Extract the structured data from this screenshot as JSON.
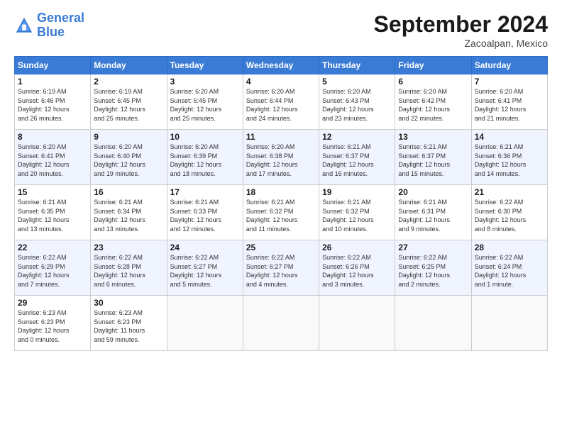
{
  "logo": {
    "line1": "General",
    "line2": "Blue"
  },
  "title": "September 2024",
  "subtitle": "Zacoalpan, Mexico",
  "headers": [
    "Sunday",
    "Monday",
    "Tuesday",
    "Wednesday",
    "Thursday",
    "Friday",
    "Saturday"
  ],
  "weeks": [
    [
      {
        "day": "1",
        "sunrise": "6:19 AM",
        "sunset": "6:46 PM",
        "daylight": "12 hours and 26 minutes."
      },
      {
        "day": "2",
        "sunrise": "6:19 AM",
        "sunset": "6:45 PM",
        "daylight": "12 hours and 25 minutes."
      },
      {
        "day": "3",
        "sunrise": "6:20 AM",
        "sunset": "6:45 PM",
        "daylight": "12 hours and 25 minutes."
      },
      {
        "day": "4",
        "sunrise": "6:20 AM",
        "sunset": "6:44 PM",
        "daylight": "12 hours and 24 minutes."
      },
      {
        "day": "5",
        "sunrise": "6:20 AM",
        "sunset": "6:43 PM",
        "daylight": "12 hours and 23 minutes."
      },
      {
        "day": "6",
        "sunrise": "6:20 AM",
        "sunset": "6:42 PM",
        "daylight": "12 hours and 22 minutes."
      },
      {
        "day": "7",
        "sunrise": "6:20 AM",
        "sunset": "6:41 PM",
        "daylight": "12 hours and 21 minutes."
      }
    ],
    [
      {
        "day": "8",
        "sunrise": "6:20 AM",
        "sunset": "6:41 PM",
        "daylight": "12 hours and 20 minutes."
      },
      {
        "day": "9",
        "sunrise": "6:20 AM",
        "sunset": "6:40 PM",
        "daylight": "12 hours and 19 minutes."
      },
      {
        "day": "10",
        "sunrise": "6:20 AM",
        "sunset": "6:39 PM",
        "daylight": "12 hours and 18 minutes."
      },
      {
        "day": "11",
        "sunrise": "6:20 AM",
        "sunset": "6:38 PM",
        "daylight": "12 hours and 17 minutes."
      },
      {
        "day": "12",
        "sunrise": "6:21 AM",
        "sunset": "6:37 PM",
        "daylight": "12 hours and 16 minutes."
      },
      {
        "day": "13",
        "sunrise": "6:21 AM",
        "sunset": "6:37 PM",
        "daylight": "12 hours and 15 minutes."
      },
      {
        "day": "14",
        "sunrise": "6:21 AM",
        "sunset": "6:36 PM",
        "daylight": "12 hours and 14 minutes."
      }
    ],
    [
      {
        "day": "15",
        "sunrise": "6:21 AM",
        "sunset": "6:35 PM",
        "daylight": "12 hours and 13 minutes."
      },
      {
        "day": "16",
        "sunrise": "6:21 AM",
        "sunset": "6:34 PM",
        "daylight": "12 hours and 13 minutes."
      },
      {
        "day": "17",
        "sunrise": "6:21 AM",
        "sunset": "6:33 PM",
        "daylight": "12 hours and 12 minutes."
      },
      {
        "day": "18",
        "sunrise": "6:21 AM",
        "sunset": "6:32 PM",
        "daylight": "12 hours and 11 minutes."
      },
      {
        "day": "19",
        "sunrise": "6:21 AM",
        "sunset": "6:32 PM",
        "daylight": "12 hours and 10 minutes."
      },
      {
        "day": "20",
        "sunrise": "6:21 AM",
        "sunset": "6:31 PM",
        "daylight": "12 hours and 9 minutes."
      },
      {
        "day": "21",
        "sunrise": "6:22 AM",
        "sunset": "6:30 PM",
        "daylight": "12 hours and 8 minutes."
      }
    ],
    [
      {
        "day": "22",
        "sunrise": "6:22 AM",
        "sunset": "6:29 PM",
        "daylight": "12 hours and 7 minutes."
      },
      {
        "day": "23",
        "sunrise": "6:22 AM",
        "sunset": "6:28 PM",
        "daylight": "12 hours and 6 minutes."
      },
      {
        "day": "24",
        "sunrise": "6:22 AM",
        "sunset": "6:27 PM",
        "daylight": "12 hours and 5 minutes."
      },
      {
        "day": "25",
        "sunrise": "6:22 AM",
        "sunset": "6:27 PM",
        "daylight": "12 hours and 4 minutes."
      },
      {
        "day": "26",
        "sunrise": "6:22 AM",
        "sunset": "6:26 PM",
        "daylight": "12 hours and 3 minutes."
      },
      {
        "day": "27",
        "sunrise": "6:22 AM",
        "sunset": "6:25 PM",
        "daylight": "12 hours and 2 minutes."
      },
      {
        "day": "28",
        "sunrise": "6:22 AM",
        "sunset": "6:24 PM",
        "daylight": "12 hours and 1 minute."
      }
    ],
    [
      {
        "day": "29",
        "sunrise": "6:23 AM",
        "sunset": "6:23 PM",
        "daylight": "12 hours and 0 minutes."
      },
      {
        "day": "30",
        "sunrise": "6:23 AM",
        "sunset": "6:23 PM",
        "daylight": "11 hours and 59 minutes."
      },
      null,
      null,
      null,
      null,
      null
    ]
  ]
}
